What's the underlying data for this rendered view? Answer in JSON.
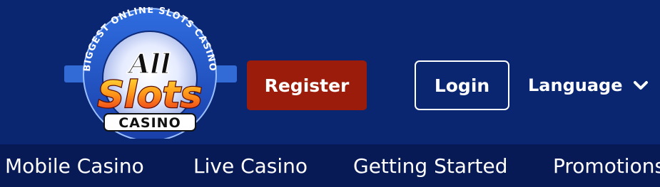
{
  "header": {
    "logo": {
      "arc_text": "BIGGEST ONLINE SLOTS CASINO",
      "line1": "All",
      "line2": "Slots",
      "line3": "CASINO"
    },
    "register_label": "Register",
    "login_label": "Login",
    "language_label": "Language"
  },
  "nav": {
    "items": [
      {
        "label": "Mobile Casino"
      },
      {
        "label": "Live Casino"
      },
      {
        "label": "Getting Started"
      },
      {
        "label": "Promotions"
      }
    ]
  },
  "colors": {
    "header_bg": "#0b2671",
    "nav_bg": "#081a55",
    "register_bg": "#9b1c0a",
    "text": "#ffffff"
  },
  "icons": {
    "language_chevron": "chevron-down-icon"
  }
}
